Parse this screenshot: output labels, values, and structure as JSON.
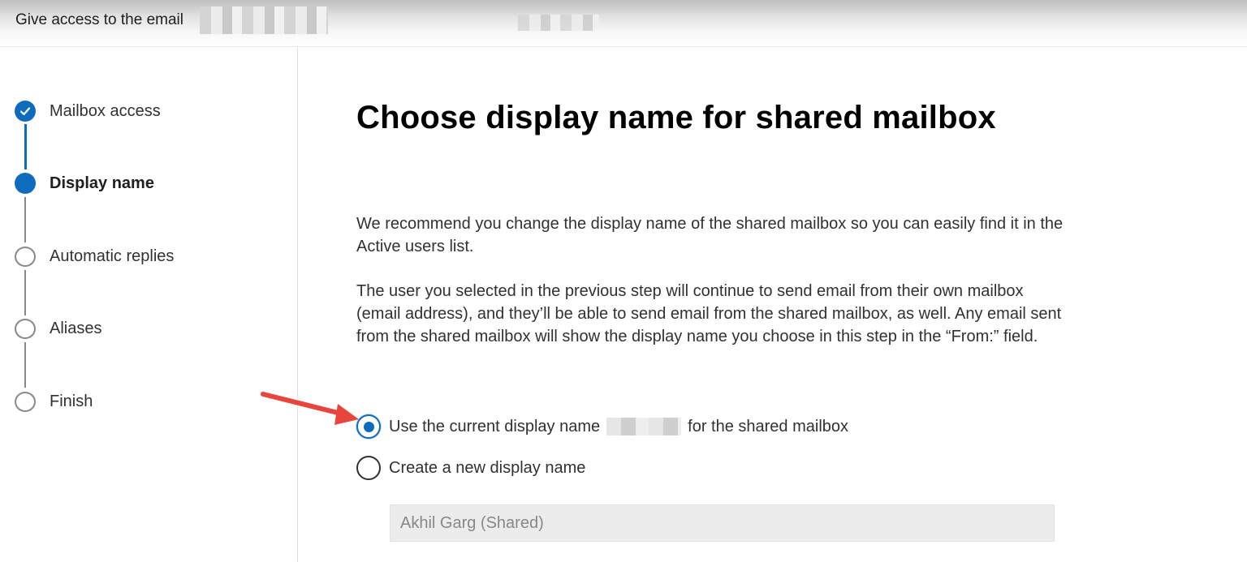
{
  "header": {
    "title": "Give access to the email"
  },
  "steps": [
    {
      "label": "Mailbox access",
      "state": "done"
    },
    {
      "label": "Display name",
      "state": "current"
    },
    {
      "label": "Automatic replies",
      "state": "todo"
    },
    {
      "label": "Aliases",
      "state": "todo"
    },
    {
      "label": "Finish",
      "state": "todo"
    }
  ],
  "main": {
    "title": "Choose display name for shared mailbox",
    "paragraph1": "We recommend you change the display name of the shared mailbox so you can easily find it in the Active users list.",
    "paragraph2": "The user you selected in the previous step will continue to send email from their own mailbox (email address), and they’ll be able to send email from the shared mailbox, as well. Any email sent from the shared mailbox will show the display name you choose in this step in the “From:” field.",
    "option_current_prefix": "Use the current display name",
    "option_current_suffix": "for the shared mailbox",
    "option_new": "Create a new display name",
    "selected_option": "current",
    "display_name_value": "Akhil Garg (Shared)"
  },
  "colors": {
    "accent": "#0f6cbd",
    "annotation_arrow": "#e8453c"
  },
  "icons": {
    "done_step": "checkmark-icon",
    "annotation": "red-arrow-icon"
  }
}
